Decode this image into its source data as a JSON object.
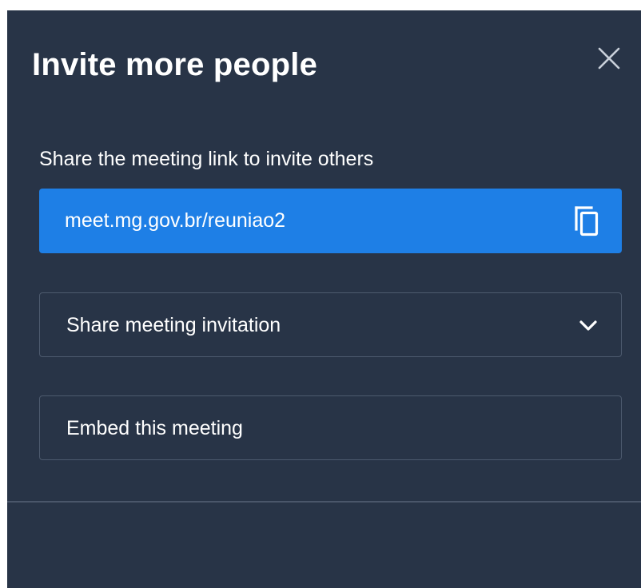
{
  "dialog": {
    "title": "Invite more people",
    "close_icon": "close-icon",
    "share_label": "Share the meeting link to invite others",
    "meeting_link": "meet.mg.gov.br/reuniao2",
    "copy_icon": "copy-icon",
    "share_invitation_label": "Share meeting invitation",
    "share_invitation_icon": "chevron-down-icon",
    "embed_label": "Embed this meeting"
  },
  "colors": {
    "dialog_background": "#283447",
    "link_background": "#1e7fe6",
    "border": "#4d5a6e",
    "text": "#ffffff"
  }
}
